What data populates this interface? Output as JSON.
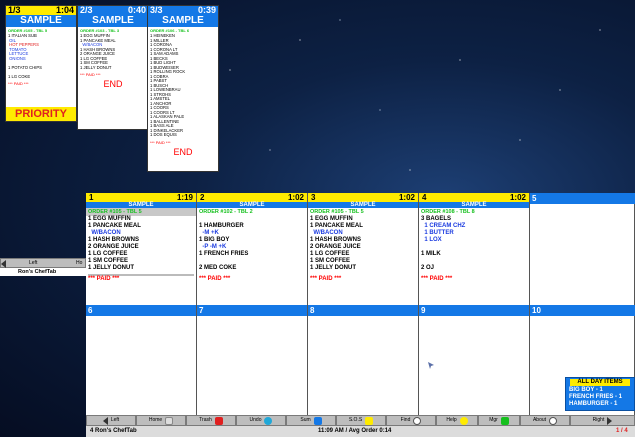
{
  "ticket_mini": [
    {
      "num": "1/3",
      "time": "1:04",
      "title": "SAMPLE",
      "order": "ORDER #105 - TBL 5",
      "items": [
        "1 ITALIAN SUB",
        " OIL",
        " HOT PEPPERS",
        " TOMATO",
        " LETTUCE",
        " ONIONS",
        "",
        "1 POTATO CHIPS",
        "",
        "1 LG COKE"
      ],
      "paid": "*** PAID ***",
      "footer": "PRIORITY"
    },
    {
      "num": "2/3",
      "time": "0:40",
      "title": "SAMPLE",
      "order": "ORDER #103 - TBL 3",
      "items": [
        "1 EGG MUFFIN",
        "1 PANCAKE MEAL",
        "  W/BACON",
        "1 HASH BROWNS",
        "2 ORANGE JUICE",
        "1 LG COFFEE",
        "1 SM COFFEE",
        "1 JELLY DONUT"
      ],
      "paid": "*** PAID ***",
      "footer": "END"
    },
    {
      "num": "3/3",
      "time": "0:39",
      "title": "SAMPLE",
      "order": "ORDER #106 - TBL 6",
      "items": [
        "1 HEINEKEN",
        "1 MILLER",
        "1 CORONA",
        "1 CORONA LT",
        "1 SAM ADAMS",
        "1 BECKS",
        "1 BUD LIGHT",
        "1 BUDWEISER",
        "1 ROLLING ROCK",
        "1 COBRA",
        "1 PABST",
        "1 BUSCH",
        "1 LOWENBRAU",
        "1 STROHS",
        "1 AMSTEL",
        "1 ANCHOR",
        "1 COORS",
        "1 COORS LT",
        "1 ALASKAN PALE",
        "1 BALLENTINE",
        "1 BASS ALE",
        "1 DINKELACKER",
        "1 DOS EQUIS"
      ],
      "paid": "*** PAID ***",
      "footer": "END"
    }
  ],
  "left_panel": {
    "left_btn": "Left",
    "right_btn_partial": "Ho",
    "footer": "Ron's ChefTab"
  },
  "tickets": [
    {
      "num": "1",
      "time": "1:19",
      "title": "SAMPLE",
      "order": "ORDER #105 - TBL 5",
      "items": [
        "1 EGG MUFFIN",
        "1 PANCAKE MEAL",
        "  W/BACON",
        "1 HASH BROWNS",
        "2 ORANGE JUICE",
        "1 LG COFFEE",
        "1 SM COFFEE",
        "1 JELLY DONUT"
      ],
      "paid": "*** PAID ***"
    },
    {
      "num": "2",
      "time": "1:02",
      "title": "SAMPLE",
      "order": "ORDER #102 - TBL 2",
      "items": [
        "",
        "1 HAMBURGER",
        "  -M +K",
        "1 BIG BOY",
        "  -P -M +K",
        "1 FRENCH FRIES",
        "",
        "2 MED COKE"
      ],
      "paid": "*** PAID ***"
    },
    {
      "num": "3",
      "time": "1:02",
      "title": "SAMPLE",
      "order": "ORDER #105 - TBL 5",
      "items": [
        "1 EGG MUFFIN",
        "1 PANCAKE MEAL",
        "  W/BACON",
        "1 HASH BROWNS",
        "2 ORANGE JUICE",
        "1 LG COFFEE",
        "1 SM COFFEE",
        "1 JELLY DONUT"
      ],
      "paid": "*** PAID ***"
    },
    {
      "num": "4",
      "time": "1:02",
      "title": "SAMPLE",
      "order": "ORDER #108 - TBL 8",
      "items": [
        "3 BAGELS",
        "  1 CREAM CHZ",
        "  1 BUTTER",
        "  1 LOX",
        "",
        "1 MILK",
        "",
        "2 OJ"
      ],
      "paid": "*** PAID ***"
    }
  ],
  "empty_slots": [
    "5",
    "6",
    "7",
    "8",
    "9",
    "10"
  ],
  "all_day": {
    "title": "ALL DAY ITEMS",
    "rows": [
      "BIG BOY - 1",
      "FRENCH FRIES - 1",
      "HAMBURGER - 1"
    ]
  },
  "buttons": {
    "left": "Left",
    "home": "Home",
    "trash": "Trash",
    "undo": "Undo",
    "sum": "Sum",
    "sos": "S.O.S",
    "find": "Find",
    "help": "Help",
    "mgr": "Mgr",
    "about": "About",
    "right": "Right"
  },
  "status": {
    "left": "4  Ron's ChefTab",
    "center": "11:09 AM / Avg Order 0:14",
    "right": "1 / 4"
  },
  "colors": {
    "header_yellow": "#ffeb00",
    "blue": "#1478e6",
    "green": "#16c01e",
    "paid_red": "#ff0000"
  }
}
